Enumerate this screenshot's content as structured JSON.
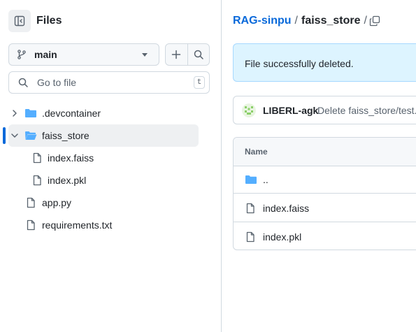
{
  "sidebar": {
    "title": "Files",
    "branch": "main",
    "search": {
      "placeholder": "Go to file",
      "shortcut": "t"
    },
    "tree": [
      {
        "label": ".devcontainer",
        "type": "folder",
        "expanded": false
      },
      {
        "label": "faiss_store",
        "type": "folder",
        "expanded": true,
        "selected": true
      },
      {
        "label": "index.faiss",
        "type": "file"
      },
      {
        "label": "index.pkl",
        "type": "file"
      },
      {
        "label": "app.py",
        "type": "file"
      },
      {
        "label": "requirements.txt",
        "type": "file"
      }
    ]
  },
  "breadcrumb": {
    "repo": "RAG-sinpu",
    "sep": "/",
    "folder": "faiss_store",
    "trailing": "/"
  },
  "flash": {
    "message": "File successfully deleted."
  },
  "commit": {
    "author": "LIBERL-agk",
    "message": "Delete faiss_store/test.txt"
  },
  "table": {
    "header": "Name",
    "rows": [
      {
        "label": "..",
        "type": "folder"
      },
      {
        "label": "index.faiss",
        "type": "file"
      },
      {
        "label": "index.pkl",
        "type": "file"
      }
    ]
  },
  "colors": {
    "accent": "#0969da",
    "folder": "#54aeff",
    "flash_bg": "#ddf4ff"
  },
  "icons": [
    "sidebar-collapse-icon",
    "git-branch-icon",
    "plus-icon",
    "search-icon",
    "chevron-right-icon",
    "chevron-down-icon",
    "folder-icon",
    "file-icon",
    "copy-icon"
  ]
}
